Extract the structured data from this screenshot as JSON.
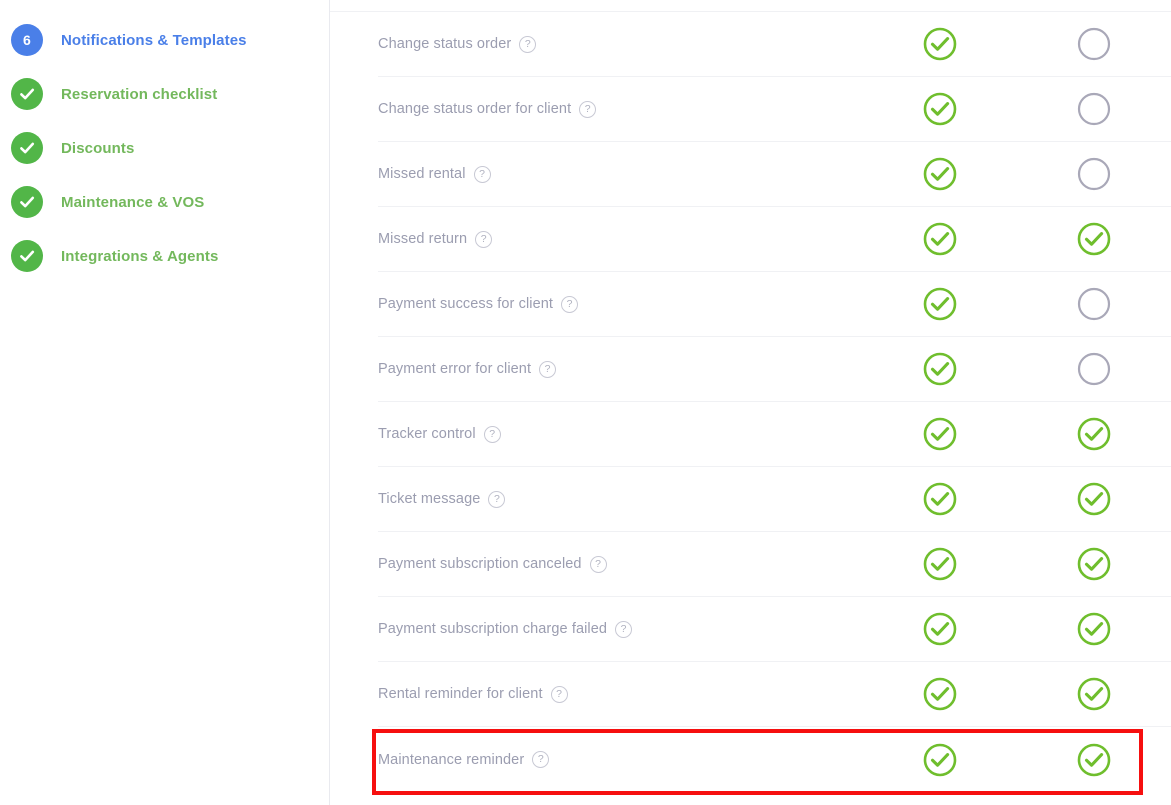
{
  "sidebar": {
    "items": [
      {
        "badge": "6",
        "badge_type": "count",
        "badge_color": "#4a7fe8",
        "label": "Notifications & Templates",
        "label_color": "#4a7fe8",
        "state": "active"
      },
      {
        "badge": "",
        "badge_type": "check",
        "badge_color": "#52b648",
        "label": "Reservation checklist",
        "label_color": "#73b85c",
        "state": "complete"
      },
      {
        "badge": "",
        "badge_type": "check",
        "badge_color": "#52b648",
        "label": "Discounts",
        "label_color": "#73b85c",
        "state": "complete"
      },
      {
        "badge": "",
        "badge_type": "check",
        "badge_color": "#52b648",
        "label": "Maintenance & VOS",
        "label_color": "#73b85c",
        "state": "complete"
      },
      {
        "badge": "",
        "badge_type": "check",
        "badge_color": "#52b648",
        "label": "Integrations & Agents",
        "label_color": "#73b85c",
        "state": "complete"
      }
    ]
  },
  "icons": {
    "help": "?",
    "help_label": "help-icon",
    "check_on": "check-circle-on-icon",
    "check_off": "circle-off-icon"
  },
  "colors": {
    "green": "#6fbe2d",
    "gray_circle": "#a9a8b8",
    "highlight": "#f60f0f",
    "row_divider": "#f0f1f4",
    "label_text": "#9b9db0"
  },
  "table": {
    "rows": [
      {
        "label": "Change status order",
        "help": "?",
        "col1": "on",
        "col2": "off"
      },
      {
        "label": "Change status order for client",
        "help": "?",
        "col1": "on",
        "col2": "off"
      },
      {
        "label": "Missed rental",
        "help": "?",
        "col1": "on",
        "col2": "off"
      },
      {
        "label": "Missed return",
        "help": "?",
        "col1": "on",
        "col2": "on"
      },
      {
        "label": "Payment success for client",
        "help": "?",
        "col1": "on",
        "col2": "off"
      },
      {
        "label": "Payment error for client",
        "help": "?",
        "col1": "on",
        "col2": "off"
      },
      {
        "label": "Tracker control",
        "help": "?",
        "col1": "on",
        "col2": "on"
      },
      {
        "label": "Ticket message",
        "help": "?",
        "col1": "on",
        "col2": "on"
      },
      {
        "label": "Payment subscription canceled",
        "help": "?",
        "col1": "on",
        "col2": "on"
      },
      {
        "label": "Payment subscription charge failed",
        "help": "?",
        "col1": "on",
        "col2": "on"
      },
      {
        "label": "Rental reminder for client",
        "help": "?",
        "col1": "on",
        "col2": "on"
      },
      {
        "label": "Maintenance reminder",
        "help": "?",
        "col1": "on",
        "col2": "on",
        "highlighted": true
      }
    ]
  }
}
